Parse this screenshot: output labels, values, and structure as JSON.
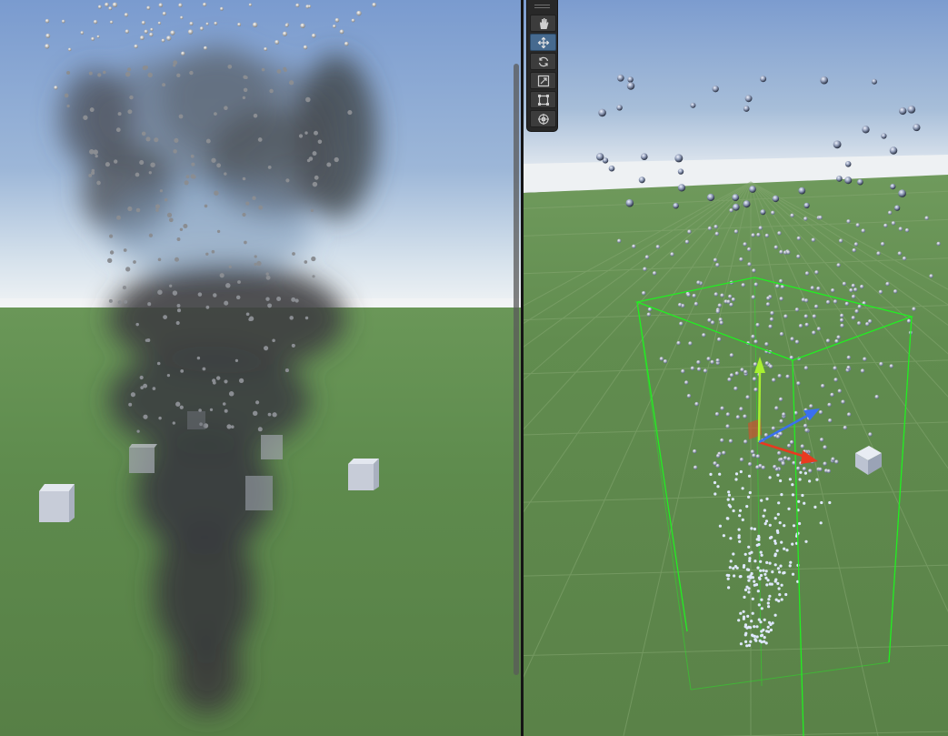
{
  "game_view": {
    "scrollbar": "vertical"
  },
  "scene_view": {
    "tool_palette": [
      {
        "tool": "hand",
        "icon": "hand-icon",
        "active": false
      },
      {
        "tool": "move",
        "icon": "move-icon",
        "active": true
      },
      {
        "tool": "rotate",
        "icon": "rotate-icon",
        "active": false
      },
      {
        "tool": "scale",
        "icon": "scale-icon",
        "active": false
      },
      {
        "tool": "rect",
        "icon": "rect-icon",
        "active": false
      },
      {
        "tool": "transform",
        "icon": "transform-icon",
        "active": false
      }
    ],
    "bounds_color": "#22ee22",
    "gizmo_colors": {
      "x": "#e83a20",
      "y": "#a8f030",
      "z": "#3a70f0"
    }
  },
  "colors": {
    "sky_top": "#7e9fcf",
    "horizon": "#e8edf0",
    "ground": "#5e8a4e",
    "smoke": "#3c3c3c"
  }
}
